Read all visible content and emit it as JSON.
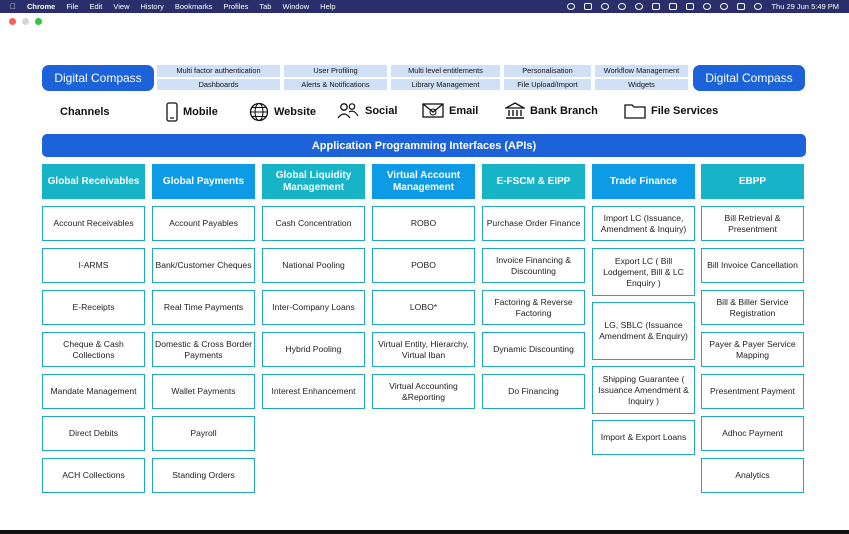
{
  "menubar": {
    "app": "Chrome",
    "items": [
      "File",
      "Edit",
      "View",
      "History",
      "Bookmarks",
      "Profiles",
      "Tab",
      "Window",
      "Help"
    ],
    "datetime": "Thu 29 Jun  5:49 PM"
  },
  "diagram": {
    "left_brand": "Digital Compass",
    "right_brand": "Digital Compass",
    "features": [
      "Multi factor authentication",
      "User Profiling",
      "Multi level entitlements",
      "Personalisation",
      "Workflow Management",
      "Dashboards",
      "Alerts & Notifications",
      "Library Management",
      "File Upload/Import",
      "Widgets"
    ],
    "channels_label": "Channels",
    "channels": [
      "Mobile",
      "Website",
      "Social",
      "Email",
      "Bank Branch",
      "File Services"
    ],
    "api_bar": "Application Programming Interfaces (APIs)",
    "columns": [
      {
        "title": "Global Receivables",
        "items": [
          "Account Receivables",
          "I-ARMS",
          "E-Receipts",
          "Cheque & Cash Collections",
          "Mandate Management",
          "Direct Debits",
          "ACH Collections"
        ]
      },
      {
        "title": "Global Payments",
        "items": [
          "Account Payables",
          "Bank/Customer Cheques",
          "Real Time Payments",
          "Domestic & Cross Border Payments",
          "Wallet Payments",
          "Payroll",
          "Standing Orders"
        ]
      },
      {
        "title": "Global Liquidity Management",
        "items": [
          "Cash Concentration",
          "National Pooling",
          "Inter-Company Loans",
          "Hybrid Pooling",
          "Interest Enhancement"
        ]
      },
      {
        "title": "Virtual Account Management",
        "items": [
          "ROBO",
          "POBO",
          "LOBO*",
          "Virtual Entity, Hierarchy, Virtual Iban",
          "Virtual Accounting &Reporting"
        ]
      },
      {
        "title": "E-FSCM & EIPP",
        "items": [
          "Purchase Order Finance",
          "Invoice Financing & Discounting",
          "Factoring & Reverse Factoring",
          "Dynamic Discounting",
          "Do Financing"
        ]
      },
      {
        "title": "Trade Finance",
        "items": [
          "Import LC (Issuance, Amendment & Inquiry)",
          "Export LC ( Bill Lodgement, Bill & LC Enquiry )",
          "LG, SBLC (Issuance Amendment & Enquiry)",
          "Shipping Guarantee ( Issuance Amendment & Inquiry )",
          "Import & Export Loans"
        ]
      },
      {
        "title": "EBPP",
        "items": [
          "Bill Retrieval & Presentment",
          "Bill Invoice Cancellation",
          "Bill & Biller Service Registration",
          "Payer & Payer Service Mapping",
          "Presentment Payment",
          "Adhoc Payment",
          "Analytics"
        ]
      }
    ]
  },
  "colors": {
    "menubar": "#2a2f6b",
    "brand_blue": "#1c62d8",
    "feature_fill": "#cfe0f7",
    "teal_header": "#17b3c6",
    "blue_header": "#0d9be6",
    "item_border": "#1fa9bd"
  }
}
